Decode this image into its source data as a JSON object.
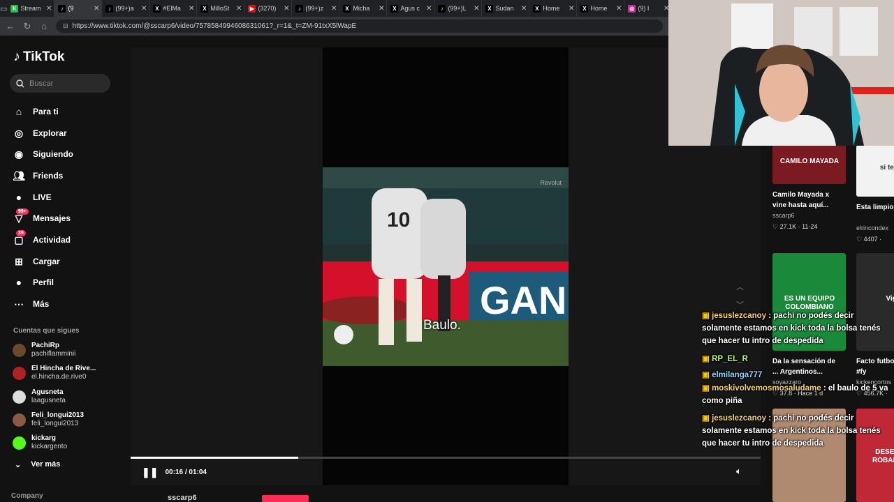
{
  "browser": {
    "tabs": [
      {
        "title": "Stream",
        "color": "#1fbf3a",
        "glyph": "K"
      },
      {
        "title": "(9",
        "color": "#000000",
        "glyph": "♪",
        "active": true
      },
      {
        "title": "(99+)a",
        "color": "#000000",
        "glyph": "♪"
      },
      {
        "title": "#ElMa",
        "color": "#000000",
        "glyph": "X"
      },
      {
        "title": "MilloSt",
        "color": "#000000",
        "glyph": "X"
      },
      {
        "title": "(3270)",
        "color": "#ff0000",
        "glyph": "▶"
      },
      {
        "title": "(99+)z",
        "color": "#000000",
        "glyph": "♪"
      },
      {
        "title": "Micha",
        "color": "#000000",
        "glyph": "X"
      },
      {
        "title": "Agus c",
        "color": "#000000",
        "glyph": "X"
      },
      {
        "title": "(99+)L",
        "color": "#000000",
        "glyph": "♪"
      },
      {
        "title": "Sudan",
        "color": "#000000",
        "glyph": "X"
      },
      {
        "title": "Home",
        "color": "#000000",
        "glyph": "X"
      },
      {
        "title": "Home",
        "color": "#000000",
        "glyph": "X"
      },
      {
        "title": "(9) I",
        "color": "#d6249f",
        "glyph": "◎"
      }
    ],
    "url": "https://www.tiktok.com/@sscarp6/video/7578584994608631061?_r=1&_t=ZM-91txX5lWapE"
  },
  "tiktok": {
    "logo": "TikTok",
    "search_placeholder": "Buscar",
    "nav": [
      {
        "label": "Para ti",
        "icon": "home-icon"
      },
      {
        "label": "Explorar",
        "icon": "compass-icon"
      },
      {
        "label": "Siguiendo",
        "icon": "following-icon"
      },
      {
        "label": "Friends",
        "icon": "friends-icon"
      },
      {
        "label": "LIVE",
        "icon": "live-icon"
      },
      {
        "label": "Mensajes",
        "icon": "messages-icon",
        "badge": "99+"
      },
      {
        "label": "Actividad",
        "icon": "activity-icon",
        "badge": "39"
      },
      {
        "label": "Cargar",
        "icon": "upload-icon"
      },
      {
        "label": "Perfil",
        "icon": "profile-icon"
      },
      {
        "label": "Más",
        "icon": "more-icon"
      }
    ],
    "following_title": "Cuentas que sigues",
    "following": [
      {
        "name": "PachiRp",
        "handle": "pachiflamminii",
        "color": "#6b4a2a"
      },
      {
        "name": "El Hincha de Rive...",
        "handle": "el.hincha.de.rive0",
        "color": "#b22222"
      },
      {
        "name": "Agusneta",
        "handle": "laagusneta",
        "color": "#dddddd"
      },
      {
        "name": "Feli_longui2013",
        "handle": "feli_longui2013",
        "color": "#8a5a44"
      },
      {
        "name": "kickarg",
        "handle": "kickargento",
        "color": "#53fc18"
      }
    ],
    "see_more": "Ver más",
    "company": "Company",
    "author": "sscarp6"
  },
  "video": {
    "caption": "Baulo.",
    "watermark": "Revolut",
    "time": "00:16 / 01:04",
    "progress_fraction": 0.266
  },
  "recommendations": [
    {
      "title": "Camilo Mayada x vine hasta aquí...",
      "user": "sscarp6",
      "meta": "27.1K · 11-24",
      "thumb_text": "CAMILO MAYADA"
    },
    {
      "title": "Esta limpio #fyp...",
      "user": "elrincondex",
      "meta": "4407 ·",
      "thumb_text": "si tengo"
    },
    {
      "title": "Da la sensación de ... Argentinos...",
      "user": "soyazzaro",
      "meta": "37.8 · Hace 1 d",
      "thumb_text": "ES UN EQUIPO COLOMBIANO"
    },
    {
      "title": "Facto futbo baulo... #fy",
      "user": "kickencortos",
      "meta": "456.7K ·",
      "thumb_text": "Vigil"
    },
    {
      "title": "",
      "user": "",
      "meta": "",
      "thumb_text": ""
    },
    {
      "title": "",
      "user": "",
      "meta": "",
      "thumb_text": "DESEAN N ROBADO EL"
    }
  ],
  "chat": [
    {
      "user": "jesuslezcanoy",
      "text": ": pachi no podés decir solamente estamos en kick toda la bolsa tenés que hacer tu intro de despedida"
    },
    {
      "user": "RP_EL_R",
      "text": ""
    },
    {
      "user": "elmilanga777",
      "text": ""
    },
    {
      "user": "moskivolvemosmosaludame",
      "text": ": el baulo de 5 va como piña"
    },
    {
      "user": "jesuslezcanoy",
      "text": ": pachi no podés decir solamente estamos en kick toda la bolsa tenés que hacer tu intro de despedida"
    }
  ]
}
